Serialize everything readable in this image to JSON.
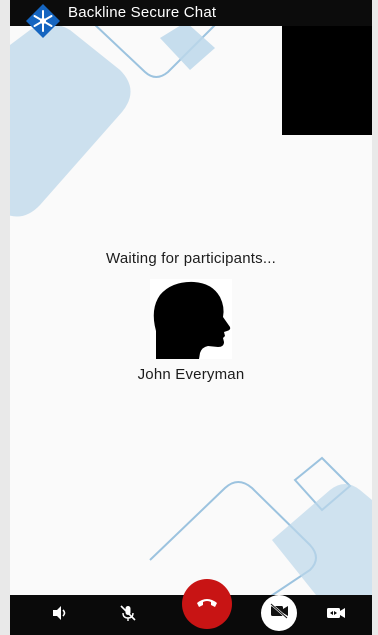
{
  "app": {
    "title": "Backline Secure Chat",
    "logo_icon": "snowflake-logo-icon"
  },
  "call": {
    "status": "Waiting for participants...",
    "participant_name": "John Everyman",
    "avatar_icon": "profile-silhouette-icon",
    "self_view": "black"
  },
  "controls": {
    "speaker_icon": "speaker-icon",
    "mute_icon": "mic-off-icon",
    "end_call_icon": "phone-hangup-icon",
    "video_toggle_icon": "video-off-icon",
    "switch_camera_icon": "switch-camera-icon"
  },
  "colors": {
    "accent_blue": "#1565c0",
    "decor_blue": "#bcd7ea",
    "end_call_red": "#c81414",
    "bar_black": "#0a0a0a"
  }
}
